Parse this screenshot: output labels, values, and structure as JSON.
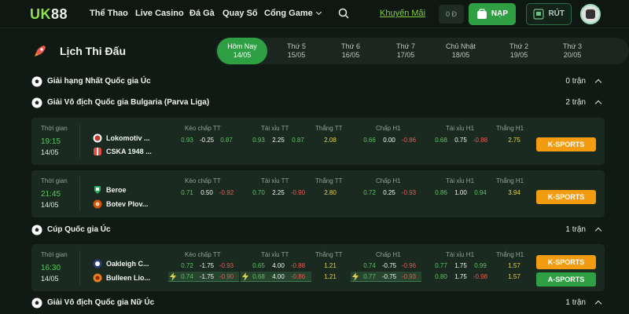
{
  "header": {
    "logo_a": "UK",
    "logo_b": "88",
    "nav": [
      "Thể Thao",
      "Live Casino",
      "Đá Gà",
      "Quay Số",
      "Cổng Game"
    ],
    "promo": "Khuyến Mãi",
    "balance": "0 Đ",
    "deposit": "NẠP",
    "withdraw": "RÚT"
  },
  "schedule": {
    "title": "Lịch Thi Đấu",
    "days": [
      {
        "name": "Hôm Nay",
        "date": "14/05",
        "active": true
      },
      {
        "name": "Thứ 5",
        "date": "15/05"
      },
      {
        "name": "Thứ 6",
        "date": "16/05"
      },
      {
        "name": "Thứ 7",
        "date": "17/05"
      },
      {
        "name": "Chủ Nhật",
        "date": "18/05"
      },
      {
        "name": "Thứ 2",
        "date": "19/05"
      },
      {
        "name": "Thứ 3",
        "date": "20/05"
      }
    ]
  },
  "labels": {
    "time": "Thời gian",
    "cols": [
      "Kèo chấp TT",
      "Tài xỉu TT",
      "Thắng TT",
      "Chấp H1",
      "Tài xỉu H1",
      "Thắng H1"
    ]
  },
  "leagues": [
    {
      "name": "Giải hạng Nhất Quốc gia Úc",
      "count": "0 trận"
    },
    {
      "name": "Giải Vô địch Quốc gia Bulgaria (Parva Liga)",
      "count": "2 trận"
    },
    {
      "name": "Cúp Quốc gia Úc",
      "count": "1 trận"
    },
    {
      "name": "Giải Vô địch Quốc gia Nữ Úc",
      "count": "1 trận"
    }
  ],
  "matches": [
    {
      "time": "19:15",
      "date": "14/05",
      "team1": "Lokomotiv ...",
      "team2": "CSKA 1948 ...",
      "odds": [
        "0.93",
        "-0.25",
        "0.87",
        "0.93",
        "2.25",
        "0.87",
        "2.08",
        "0.66",
        "0.00",
        "-0.86",
        "0.68",
        "0.75",
        "-0.88",
        "2.75"
      ],
      "button": "K-SPORTS"
    },
    {
      "time": "21:45",
      "date": "14/05",
      "team1": "Beroe",
      "team2": "Botev Plov...",
      "odds": [
        "0.71",
        "0.50",
        "-0.92",
        "0.70",
        "2.25",
        "-0.90",
        "2.80",
        "0.72",
        "0.25",
        "-0.93",
        "0.86",
        "1.00",
        "0.94",
        "3.94"
      ],
      "button": "K-SPORTS"
    },
    {
      "time": "16:30",
      "date": "14/05",
      "team1": "Oakleigh C...",
      "team2": "Bulleen Lio...",
      "odds": [
        "0.72",
        "-1.75",
        "-0.93",
        "0.65",
        "4.00",
        "-0.88",
        "1.21",
        "0.74",
        "-0.75",
        "-0.96",
        "0.77",
        "1.75",
        "0.99",
        "1.57"
      ],
      "odds2": [
        "0.74",
        "-1.75",
        "-0.90",
        "0.68",
        "4.00",
        "-0.86",
        "1.21",
        "0.77",
        "-0.75",
        "-0.93",
        "0.80",
        "1.75",
        "-0.98",
        "1.57"
      ],
      "button": "K-SPORTS",
      "button2": "A-SPORTS"
    }
  ]
}
